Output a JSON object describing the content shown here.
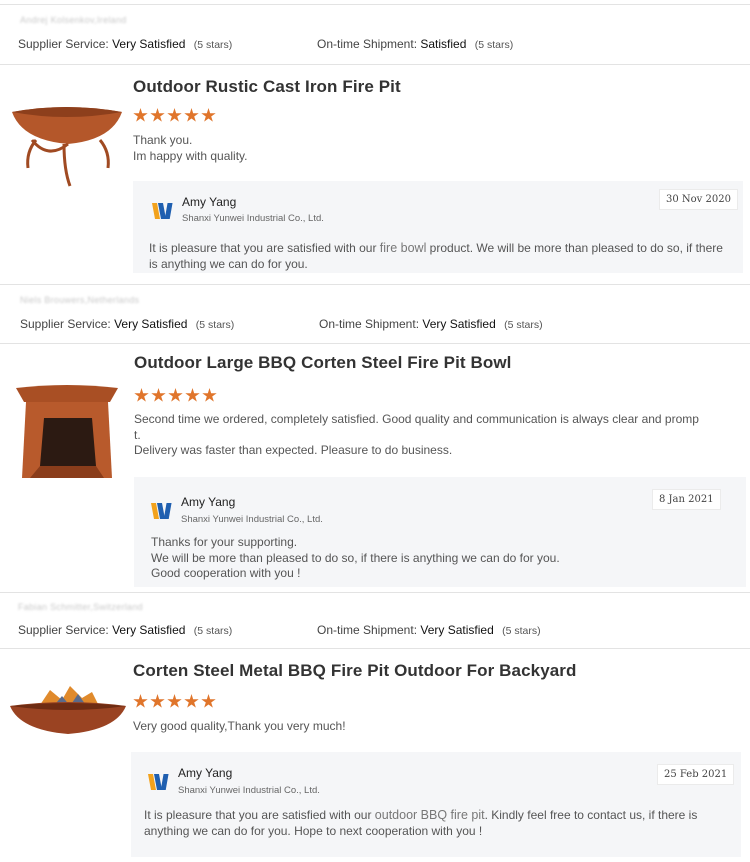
{
  "reviews": [
    {
      "reviewer": "Andrej Kolsenkov,Ireland",
      "supplier_label": "Supplier Service:",
      "supplier_value": "Very Satisfied",
      "supplier_stars": "(5 stars)",
      "shipment_label": "On-time Shipment:",
      "shipment_value": "Satisfied",
      "shipment_stars": "(5 stars)",
      "title": "Outdoor Rustic Cast Iron Fire Pit",
      "rating": 5,
      "comment_lines": [
        "Thank you.",
        "Im happy with quality."
      ],
      "reply": {
        "name": "Amy Yang",
        "company": "Shanxi Yunwei Industrial Co., Ltd.",
        "date": "30 Nov 2020",
        "text_pre": "It is pleasure that you are satisfied with our ",
        "keyword": "fire bowl",
        "text_post": " product. We will be more than pleased to do so, if there is anything we can do for you."
      }
    },
    {
      "reviewer": "Niels Brouwers,Netherlands",
      "supplier_label": "Supplier Service:",
      "supplier_value": "Very Satisfied",
      "supplier_stars": "(5 stars)",
      "shipment_label": "On-time Shipment:",
      "shipment_value": "Very Satisfied",
      "shipment_stars": "(5 stars)",
      "title": "Outdoor Large BBQ Corten Steel Fire Pit Bowl",
      "rating": 5,
      "comment_lines": [
        "Second time we ordered, completely satisfied. Good quality and communication is always clear and promp",
        "t.",
        "Delivery was faster than expected. Pleasure to do business."
      ],
      "reply": {
        "name": "Amy Yang",
        "company": "Shanxi Yunwei Industrial Co., Ltd.",
        "date": "8 Jan 2021",
        "lines": [
          "Thanks for your supporting.",
          "We will be more than pleased to do so, if there is anything we can do for you.",
          "Good cooperation with you !"
        ]
      }
    },
    {
      "reviewer": "Fabian Schmitter,Switzerland",
      "supplier_label": "Supplier Service:",
      "supplier_value": "Very Satisfied",
      "supplier_stars": "(5 stars)",
      "shipment_label": "On-time Shipment:",
      "shipment_value": "Very Satisfied",
      "shipment_stars": "(5 stars)",
      "title": "Corten Steel Metal BBQ Fire Pit Outdoor For Backyard",
      "rating": 5,
      "comment_lines": [
        "Very good quality,Thank you very much!"
      ],
      "reply": {
        "name": "Amy Yang",
        "company": "Shanxi Yunwei Industrial Co., Ltd.",
        "date": "25 Feb 2021",
        "text_pre": "It is pleasure that you are satisfied with our ",
        "keyword": "outdoor BBQ fire pit",
        "text_post": ". Kindly feel free to contact us, if there is anything we can do for you. Hope to next cooperation with you !"
      }
    }
  ],
  "colors": {
    "star": "#e0752b",
    "reply_bg": "#f5f6f8",
    "rust": "#b4572a"
  },
  "icons": {
    "logo": "company-logo-icon",
    "star": "star-icon"
  }
}
